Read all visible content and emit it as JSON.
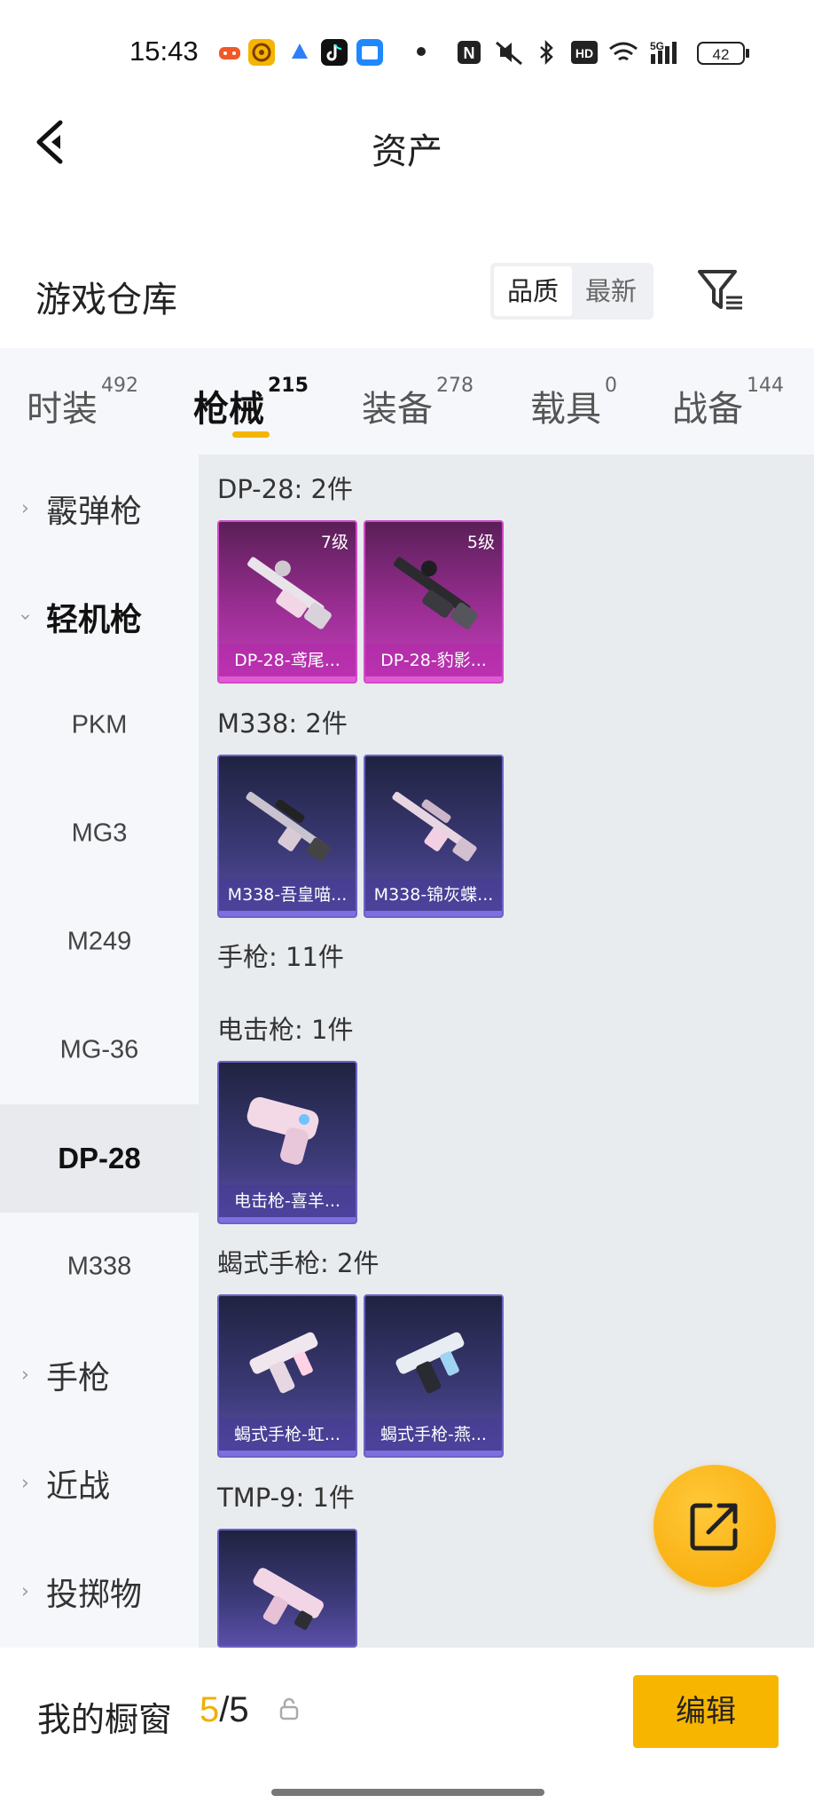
{
  "status_bar": {
    "time": "15:43",
    "signal": "5G",
    "battery": "42",
    "hd": "HD",
    "nfc": "N"
  },
  "header": {
    "title": "资产"
  },
  "section": {
    "title": "游戏仓库",
    "sort_options": [
      "品质",
      "最新"
    ],
    "selected_sort": "品质"
  },
  "tabs": [
    {
      "label": "时装",
      "count": "492"
    },
    {
      "label": "枪械",
      "count": "215",
      "active": true
    },
    {
      "label": "装备",
      "count": "278"
    },
    {
      "label": "载具",
      "count": "0"
    },
    {
      "label": "战备",
      "count": "144"
    }
  ],
  "sidebar": {
    "items": [
      {
        "label": "霰弹枪",
        "type": "category",
        "expanded": false
      },
      {
        "label": "轻机枪",
        "type": "category",
        "expanded": true
      },
      {
        "label": "PKM",
        "type": "sub"
      },
      {
        "label": "MG3",
        "type": "sub"
      },
      {
        "label": "M249",
        "type": "sub"
      },
      {
        "label": "MG-36",
        "type": "sub"
      },
      {
        "label": "DP-28",
        "type": "sub",
        "selected": true
      },
      {
        "label": "M338",
        "type": "sub"
      },
      {
        "label": "手枪",
        "type": "category",
        "expanded": false
      },
      {
        "label": "近战",
        "type": "category",
        "expanded": false
      },
      {
        "label": "投掷物",
        "type": "category",
        "expanded": false
      }
    ]
  },
  "groups": [
    {
      "title": "DP-28: 2件",
      "items": [
        {
          "name": "DP-28-鸢尾...",
          "level": "7级",
          "quality": "purple"
        },
        {
          "name": "DP-28-豹影...",
          "level": "5级",
          "quality": "purple"
        }
      ]
    },
    {
      "title": "M338: 2件",
      "items": [
        {
          "name": "M338-吾皇喵...",
          "quality": "blue"
        },
        {
          "name": "M338-锦灰蝶...",
          "quality": "blue"
        }
      ]
    },
    {
      "title": "手枪: 11件",
      "items": []
    },
    {
      "title": "电击枪: 1件",
      "items": [
        {
          "name": "电击枪-喜羊...",
          "quality": "blue"
        }
      ]
    },
    {
      "title": "蝎式手枪: 2件",
      "items": [
        {
          "name": "蝎式手枪-虹...",
          "quality": "blue"
        },
        {
          "name": "蝎式手枪-燕...",
          "quality": "blue"
        }
      ]
    },
    {
      "title": "TMP-9: 1件",
      "items": [
        {
          "name": "",
          "quality": "blue"
        }
      ]
    }
  ],
  "bottom": {
    "showcase_label": "我的橱窗",
    "current": "5",
    "total": "/5",
    "edit_label": "编辑"
  },
  "colors": {
    "accent": "#f7b500",
    "purple_quality": "#c53fbc",
    "blue_quality": "#5a4fa8"
  }
}
